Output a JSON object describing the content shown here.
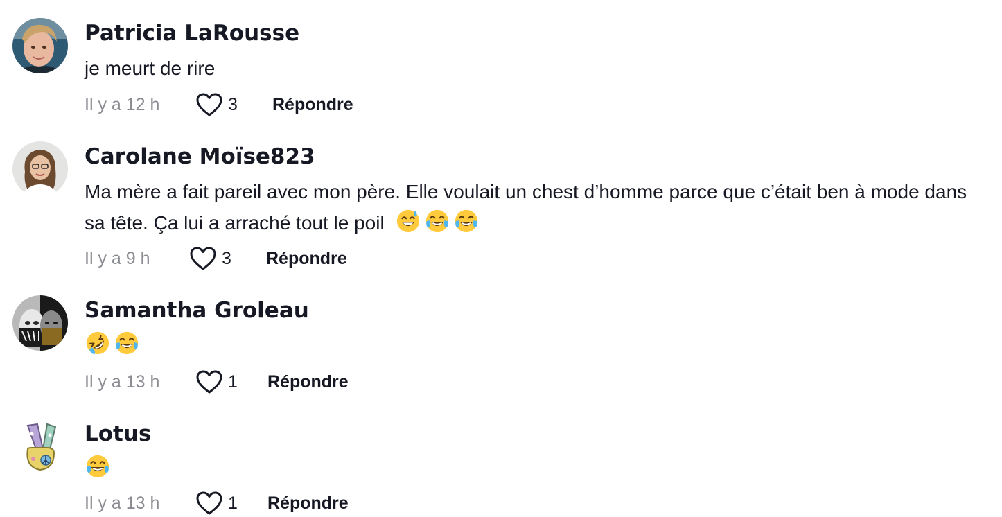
{
  "comments": [
    {
      "username": "Patricia LaRousse",
      "text": "je meurt de rire",
      "emojis": [],
      "time": "Il y a 12 h",
      "likes": "3",
      "reply_label": "Répondre"
    },
    {
      "username": "Carolane Moïse823",
      "text": "Ma mère a fait pareil avec mon père. Elle voulait un chest d’homme parce que c’était ben à mode dans sa tête. Ça lui a arraché tout le poil",
      "emojis": [
        "grinning-face-with-sweat",
        "face-with-tears-of-joy",
        "face-with-tears-of-joy"
      ],
      "time": "Il y a 9 h",
      "likes": "3",
      "reply_label": "Répondre"
    },
    {
      "username": "Samantha Groleau",
      "text": "",
      "emojis": [
        "rolling-on-the-floor-laughing",
        "face-with-tears-of-joy"
      ],
      "time": "Il y a 13 h",
      "likes": "1",
      "reply_label": "Répondre"
    },
    {
      "username": "Lotus",
      "text": "",
      "emojis": [
        "face-with-tears-of-joy"
      ],
      "time": "Il y a 13 h",
      "likes": "1",
      "reply_label": "Répondre"
    }
  ],
  "colors": {
    "text_primary": "#161823",
    "text_secondary": "#8a8b91",
    "background": "#ffffff",
    "emoji_yellow": "#ffcb3d",
    "emoji_tear": "#4fb6f0"
  },
  "icons": {
    "like": "heart-outline-icon"
  }
}
